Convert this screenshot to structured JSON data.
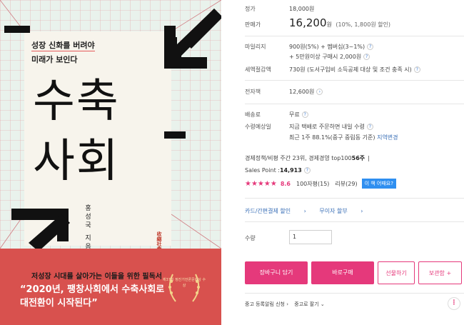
{
  "cover": {
    "subtitle_line1": "성장 신화를 버려야",
    "subtitle_line2": "미래가 보인다",
    "title_line1": "수축",
    "title_line2": "사회",
    "author": "홍성국 지음",
    "publisher": "收縮社會",
    "band_lead": "저성장 시대를 살아가는 이들을 위한 필독서",
    "band_quote": "“2020년, 팽창사회에서 수축사회로 대전환이 시작된다”",
    "award_text": "제37회 정진기언론문화상 수상"
  },
  "info": {
    "list_price_label": "정가",
    "list_price": "18,000원",
    "sale_price_label": "판매가",
    "sale_price": "16,200",
    "sale_price_unit": "원",
    "sale_price_note": "(10%, 1,800원 할인)",
    "mileage_label": "마일리지",
    "mileage_line1": "900원(5%) + 멤버십(3~1%)",
    "mileage_line2": "+ 5만원이상 구매시 2,000원",
    "tax_label": "세액절감액",
    "tax_value": "730원 (도서구입비 소득공제 대상 및 조건 충족 시)",
    "ebook_label": "전자책",
    "ebook_value": "12,600원",
    "shipping_label": "배송료",
    "shipping_value": "무료",
    "delivery_label": "수령예상일",
    "delivery_value": "지금 택배로 주문하면 내일 수령",
    "delivery_sub": "최근 1주 88.1%(중구 중림동 기준)",
    "delivery_change": "지역변경",
    "rank_prefix": "경제정책/비평 주간 23위, 경제경영 top100 ",
    "rank_weeks": "56주",
    "sales_point_label": "Sales Point : ",
    "sales_point_value": "14,913",
    "rating_stars": "★★★★★",
    "rating_score": "8.6",
    "review_count_100": "100자평(15)",
    "review_count": "리뷰(29)",
    "review_badge": "이 책 어때요?",
    "card_discount": "카드/간편결제 할인",
    "interest_free": "무이자 할부",
    "quantity_label": "수량",
    "quantity_value": "1",
    "btn_cart": "장바구니 담기",
    "btn_buy": "바로구매",
    "btn_gift": "선물하기",
    "btn_store": "보관함 +",
    "used_alert": "중고 등록알림 신청",
    "used_sell": "중고로 팔기"
  }
}
